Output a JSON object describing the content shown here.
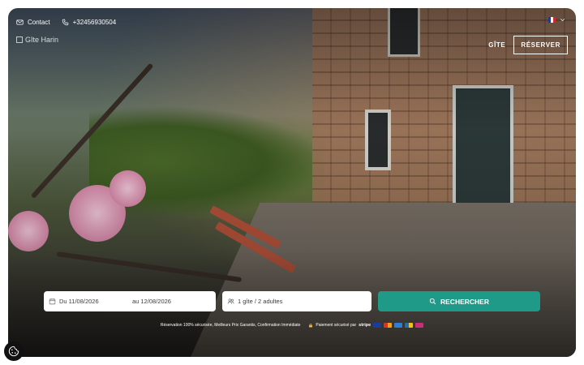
{
  "topbar": {
    "contact_label": "Contact",
    "phone_label": "+32456930504"
  },
  "logo": {
    "alt_text": "Gîte Harin"
  },
  "nav": {
    "gite_label": "GÎTE",
    "reserve_label": "RÉSERVER"
  },
  "search": {
    "date_from": "Du 11/08/2026",
    "date_to": "au 12/08/2026",
    "guests": "1 gîte / 2 adultes",
    "button_label": "RECHERCHER"
  },
  "trust": {
    "guarantees": "Réservation 100% sécurisée, Meilleurs Prix Garantis, Confirmation Immédiate",
    "payment_label": "Paiement sécurisé par",
    "stripe_label": "stripe"
  },
  "colors": {
    "accent": "#1f9a88",
    "flag": [
      "#1f3b8f",
      "#ffffff",
      "#d8262f"
    ]
  },
  "icons": [
    "mail-icon",
    "phone-icon",
    "flag-fr-icon",
    "chevron-down-icon",
    "calendar-icon",
    "users-icon",
    "search-icon",
    "lock-icon",
    "cookie-icon"
  ]
}
